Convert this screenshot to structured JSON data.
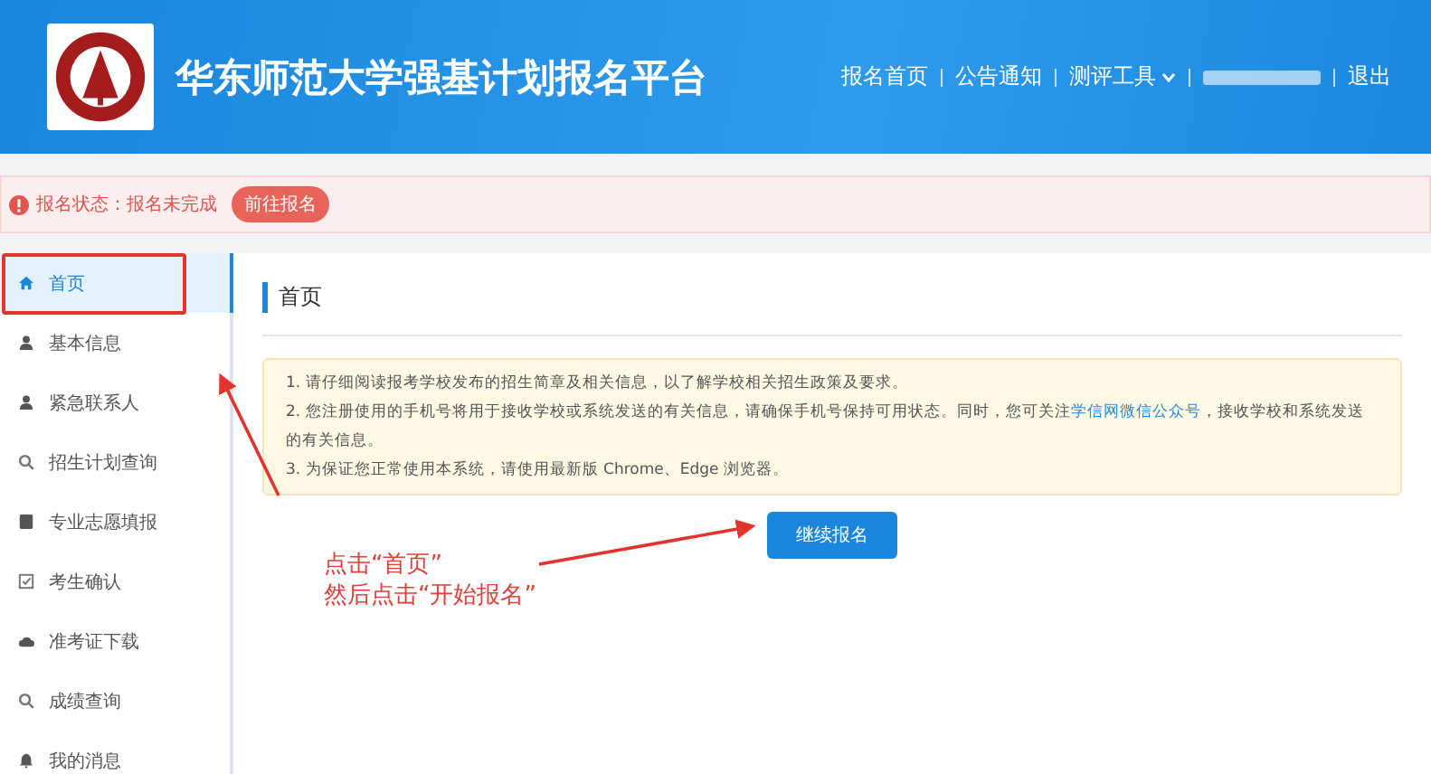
{
  "header": {
    "title": "华东师范大学强基计划报名平台",
    "nav": [
      {
        "label": "报名首页",
        "kind": "link"
      },
      {
        "label": "公告通知",
        "kind": "link"
      },
      {
        "label": "测评工具",
        "kind": "dropdown"
      },
      {
        "kind": "redacted"
      },
      {
        "label": "退出",
        "kind": "link"
      }
    ]
  },
  "status_bar": {
    "label": "报名状态：报名未完成",
    "button": "前往报名"
  },
  "sidebar": {
    "items": [
      {
        "label": "首页",
        "kind": "home",
        "selected": true
      },
      {
        "label": "基本信息",
        "kind": "user",
        "selected": false
      },
      {
        "label": "紧急联系人",
        "kind": "user",
        "selected": false
      },
      {
        "label": "招生计划查询",
        "kind": "search",
        "selected": false
      },
      {
        "label": "专业志愿填报",
        "kind": "book",
        "selected": false
      },
      {
        "label": "考生确认",
        "kind": "check",
        "selected": false
      },
      {
        "label": "准考证下载",
        "kind": "cloud",
        "selected": false
      },
      {
        "label": "成绩查询",
        "kind": "search",
        "selected": false
      },
      {
        "label": "我的消息",
        "kind": "bell",
        "selected": false
      }
    ]
  },
  "main": {
    "title": "首页",
    "notice": [
      {
        "text": "1. 请仔细阅读报考学校发布的招生简章及相关信息，以了解学校相关招生政策及要求。"
      },
      {
        "text": "2. 您注册使用的手机号将用于接收学校或系统发送的有关信息，请确保手机号保持可用状态。同时，您可关注",
        "link": "学信网微信公众号",
        "after": "，接收学校和系统发送的有关信息。"
      },
      {
        "text": "3. 为保证您正常使用本系统，请使用最新版 Chrome、Edge 浏览器。"
      }
    ],
    "button": "继续报名"
  },
  "annotation": {
    "lines": [
      "点击“首页”",
      "然后点击“开始报名”"
    ]
  }
}
